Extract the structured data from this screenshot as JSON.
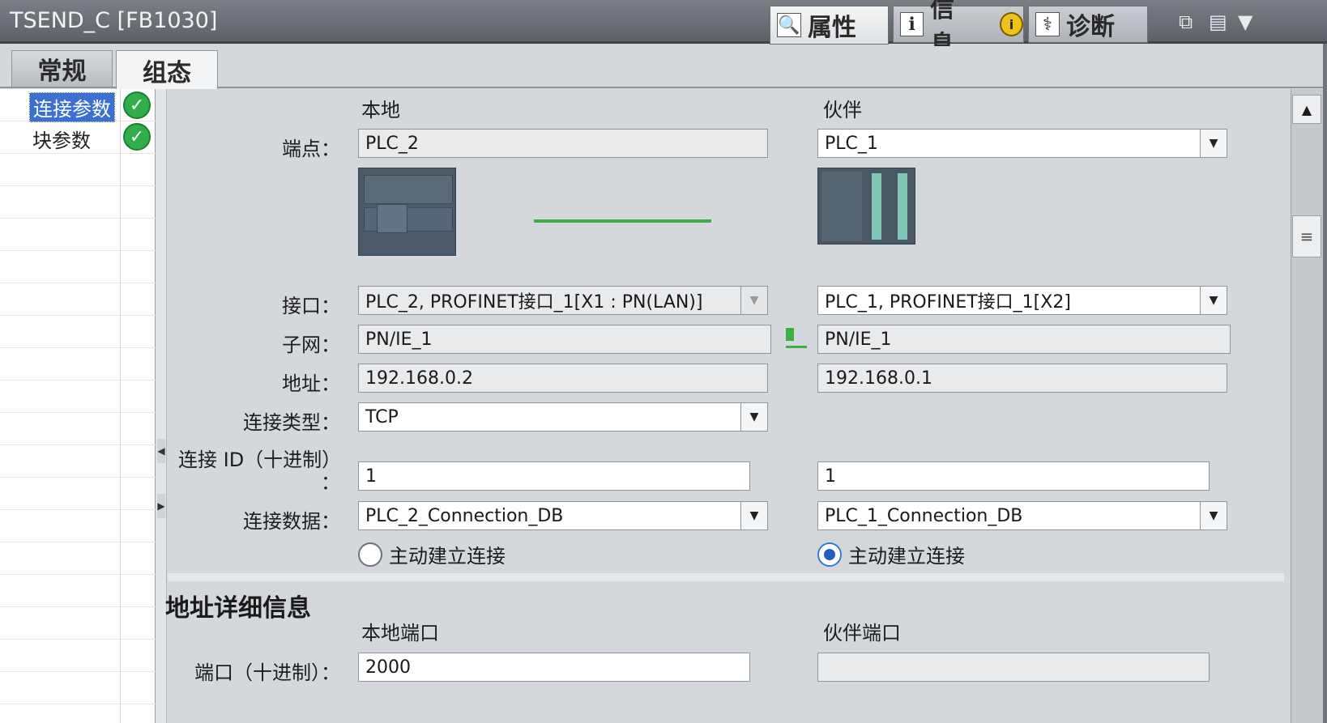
{
  "window": {
    "title": "TSEND_C [FB1030]"
  },
  "top_tabs": {
    "properties": "属性",
    "info": "信息",
    "info_badge": "i",
    "diagnostics": "诊断"
  },
  "sub_tabs": {
    "general": "常规",
    "configuration": "组态"
  },
  "nav": {
    "items": [
      {
        "label": "连接参数",
        "selected": true,
        "status": "ok"
      },
      {
        "label": "块参数",
        "selected": false,
        "status": "ok"
      }
    ]
  },
  "columns": {
    "local": "本地",
    "partner": "伙伴"
  },
  "labels": {
    "endpoint": "端点：",
    "interface": "接口：",
    "subnet": "子网：",
    "address": "地址：",
    "connection_type": "连接类型：",
    "connection_id_line1": "连接 ID（十进制）",
    "connection_id_line2": "：",
    "connection_data": "连接数据："
  },
  "local": {
    "endpoint": "PLC_2",
    "interface": "PLC_2, PROFINET接口_1[X1 : PN(LAN)]",
    "subnet": "PN/IE_1",
    "address": "192.168.0.2",
    "connection_type": "TCP",
    "connection_id": "1",
    "connection_data": "PLC_2_Connection_DB",
    "active_label": "主动建立连接",
    "active_checked": false,
    "port": "2000"
  },
  "partner": {
    "endpoint": "PLC_1",
    "interface": "PLC_1, PROFINET接口_1[X2]",
    "subnet": "PN/IE_1",
    "address": "192.168.0.1",
    "connection_id": "1",
    "connection_data": "PLC_1_Connection_DB",
    "active_label": "主动建立连接",
    "active_checked": true,
    "port": ""
  },
  "address_details": {
    "title": "地址详细信息",
    "local_port_header": "本地端口",
    "partner_port_header": "伙伴端口",
    "port_label": "端口（十进制）："
  },
  "colors": {
    "link_line": "#3cb043",
    "selection": "#3d6fd1",
    "check": "#2fae4a"
  }
}
